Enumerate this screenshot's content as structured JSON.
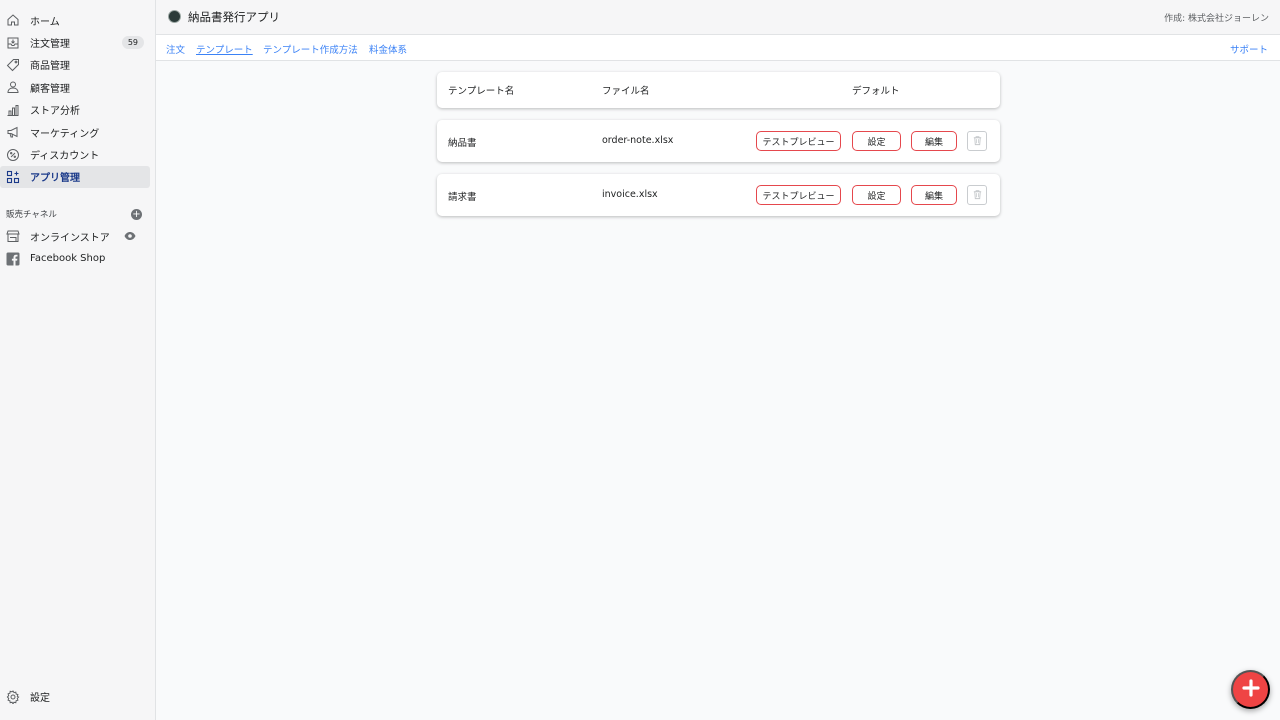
{
  "sidebar": {
    "nav": [
      {
        "label": "ホーム",
        "icon": "home-icon"
      },
      {
        "label": "注文管理",
        "icon": "orders-icon",
        "badge": "59"
      },
      {
        "label": "商品管理",
        "icon": "tag-icon"
      },
      {
        "label": "顧客管理",
        "icon": "person-icon"
      },
      {
        "label": "ストア分析",
        "icon": "bar-chart-icon"
      },
      {
        "label": "マーケティング",
        "icon": "megaphone-icon"
      },
      {
        "label": "ディスカウント",
        "icon": "discount-icon"
      },
      {
        "label": "アプリ管理",
        "icon": "apps-icon",
        "active": true
      }
    ],
    "channels_title": "販売チャネル",
    "channels": [
      {
        "label": "オンラインストア",
        "icon": "store-icon"
      },
      {
        "label": "Facebook Shop",
        "icon": "facebook-icon"
      }
    ],
    "settings_label": "設定"
  },
  "topbar": {
    "app_title": "納品書発行アプリ",
    "author": "作成: 株式会社ジョーレン"
  },
  "tabs": {
    "items": [
      "注文",
      "テンプレート",
      "テンプレート作成方法",
      "料金体系"
    ],
    "support": "サポート"
  },
  "table": {
    "headers": {
      "name": "テンプレート名",
      "file": "ファイル名",
      "default": "デフォルト"
    },
    "rows": [
      {
        "name": "納品書",
        "file": "order-note.xlsx"
      },
      {
        "name": "請求書",
        "file": "invoice.xlsx"
      }
    ],
    "actions": {
      "preview": "テストプレビュー",
      "settings": "設定",
      "edit": "編集"
    }
  },
  "colors": {
    "accent": "#3b82f6",
    "danger": "#ef4444",
    "active_text": "#1b3a8a"
  }
}
